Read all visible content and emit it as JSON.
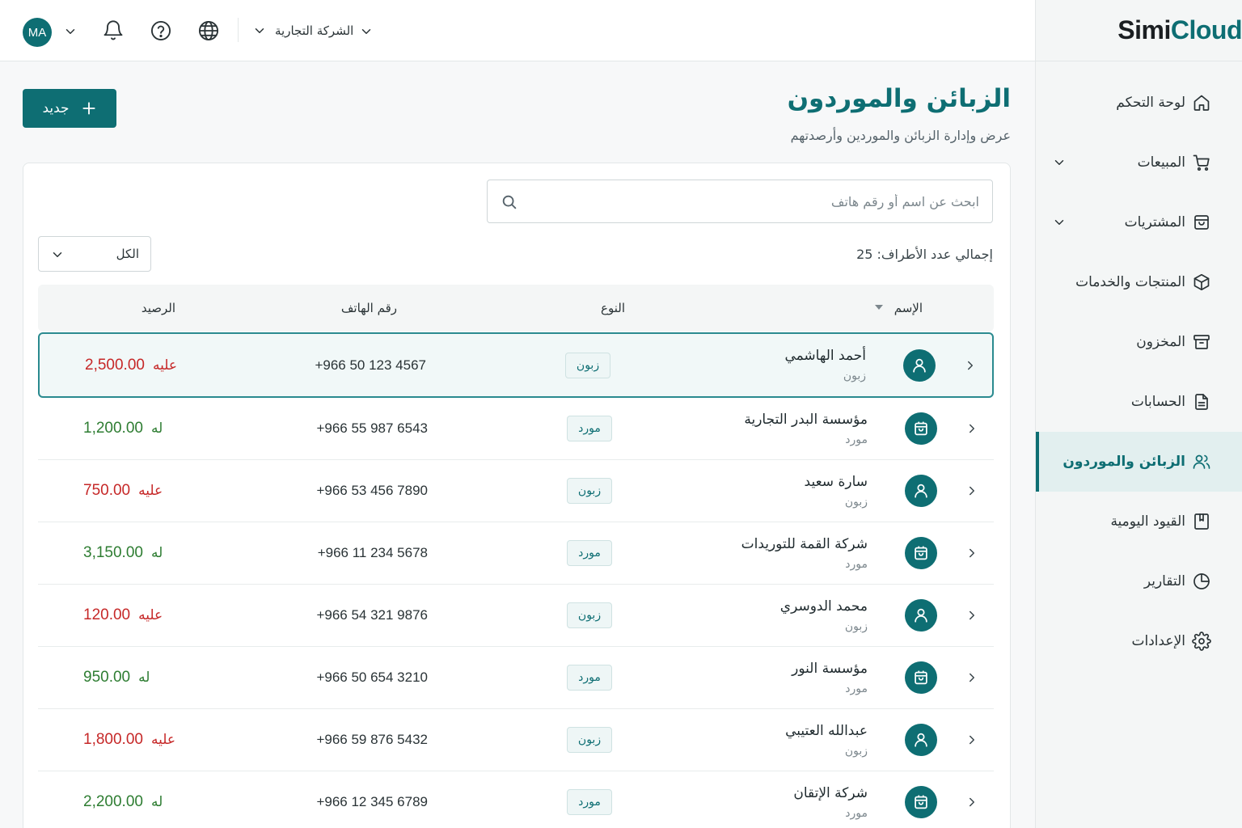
{
  "brand": {
    "logo_simi": "Simi",
    "logo_cloud": "Cloud",
    "accent_color": "#0e6e73"
  },
  "topbar": {
    "avatar_initials": "MA",
    "company_name": "الشركة التجارية"
  },
  "sidebar": {
    "items": [
      {
        "label": "لوحة التحكم",
        "icon": "home-icon",
        "has_submenu": false,
        "active": false
      },
      {
        "label": "المبيعات",
        "icon": "cart-icon",
        "has_submenu": true,
        "active": false
      },
      {
        "label": "المشتريات",
        "icon": "shopping-bag-icon",
        "has_submenu": true,
        "active": false
      },
      {
        "label": "المنتجات والخدمات",
        "icon": "box-icon",
        "has_submenu": false,
        "active": false
      },
      {
        "label": "المخزون",
        "icon": "archive-icon",
        "has_submenu": false,
        "active": false
      },
      {
        "label": "الحسابات",
        "icon": "document-icon",
        "has_submenu": false,
        "active": false
      },
      {
        "label": "الزبائن والموردون",
        "icon": "users-icon",
        "has_submenu": false,
        "active": true
      },
      {
        "label": "القيود اليومية",
        "icon": "journal-icon",
        "has_submenu": false,
        "active": false
      },
      {
        "label": "التقارير",
        "icon": "pie-chart-icon",
        "has_submenu": false,
        "active": false
      },
      {
        "label": "الإعدادات",
        "icon": "gear-icon",
        "has_submenu": false,
        "active": false
      }
    ]
  },
  "page": {
    "title": "الزبائن والموردون",
    "subtitle": "عرض وإدارة الزبائن والموردين وأرصدتهم",
    "new_button_label": "جديد"
  },
  "search": {
    "placeholder": "ابحث عن اسم أو رقم هاتف",
    "value": ""
  },
  "summary": {
    "total_label": "إجمالي عدد الأطراف: 25"
  },
  "filter": {
    "selected": "الكل"
  },
  "table": {
    "headers": {
      "name": "الإسم",
      "type": "النوع",
      "phone": "رقم الهاتف",
      "balance": "الرصيد"
    },
    "rows": [
      {
        "name": "أحمد الهاشمي",
        "kind": "زبون",
        "type": "زبون",
        "phone": "+966 50 123 4567",
        "amount": "2,500.00",
        "balance_label": "عليه",
        "direction": "debit",
        "selected": true
      },
      {
        "name": "مؤسسة البدر التجارية",
        "kind": "مورد",
        "type": "مورد",
        "phone": "+966 55 987 6543",
        "amount": "1,200.00",
        "balance_label": "له",
        "direction": "credit",
        "selected": false
      },
      {
        "name": "سارة سعيد",
        "kind": "زبون",
        "type": "زبون",
        "phone": "+966 53 456 7890",
        "amount": "750.00",
        "balance_label": "عليه",
        "direction": "debit",
        "selected": false
      },
      {
        "name": "شركة القمة للتوريدات",
        "kind": "مورد",
        "type": "مورد",
        "phone": "+966 11 234 5678",
        "amount": "3,150.00",
        "balance_label": "له",
        "direction": "credit",
        "selected": false
      },
      {
        "name": "محمد الدوسري",
        "kind": "زبون",
        "type": "زبون",
        "phone": "+966 54 321 9876",
        "amount": "120.00",
        "balance_label": "عليه",
        "direction": "debit",
        "selected": false
      },
      {
        "name": "مؤسسة النور",
        "kind": "مورد",
        "type": "مورد",
        "phone": "+966 50 654 3210",
        "amount": "950.00",
        "balance_label": "له",
        "direction": "credit",
        "selected": false
      },
      {
        "name": "عبدالله العتيبي",
        "kind": "زبون",
        "type": "زبون",
        "phone": "+966 59 876 5432",
        "amount": "1,800.00",
        "balance_label": "عليه",
        "direction": "debit",
        "selected": false
      },
      {
        "name": "شركة الإتقان",
        "kind": "مورد",
        "type": "مورد",
        "phone": "+966 12 345 6789",
        "amount": "2,200.00",
        "balance_label": "له",
        "direction": "credit",
        "selected": false
      }
    ]
  },
  "colors": {
    "debit": "#c62828",
    "credit": "#2e7d32",
    "accent": "#0e6e73"
  }
}
